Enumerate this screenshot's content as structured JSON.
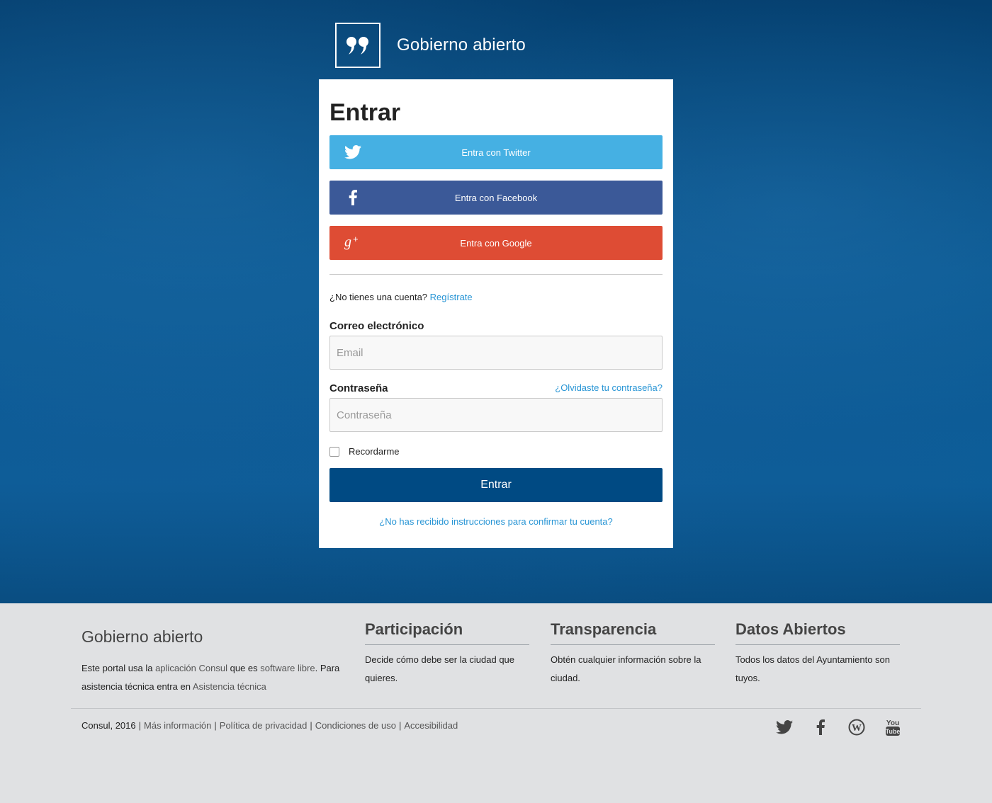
{
  "header": {
    "logo_text": "Gobierno abierto"
  },
  "login": {
    "title": "Entrar",
    "twitter_label": "Entra con Twitter",
    "facebook_label": "Entra con Facebook",
    "google_label": "Entra con Google",
    "no_account_text": "¿No tienes una cuenta?",
    "register_link": "Regístrate",
    "email_label": "Correo electrónico",
    "email_placeholder": "Email",
    "password_label": "Contraseña",
    "password_placeholder": "Contraseña",
    "forgot_link": "¿Olvidaste tu contraseña?",
    "remember_label": "Recordarme",
    "submit_label": "Entrar",
    "confirm_link": "¿No has recibido instrucciones para confirmar tu cuenta?"
  },
  "colors": {
    "twitter": "#45b0e3",
    "facebook": "#3b5998",
    "google": "#de4c34",
    "primary": "#004a83",
    "link": "#2895d5"
  },
  "footer": {
    "title": "Gobierno abierto",
    "desc_1": "Este portal usa la",
    "desc_link_1": "aplicación Consul",
    "desc_2": "que es",
    "desc_link_2": "software libre",
    "desc_3": ". Para asistencia técnica entra en",
    "desc_link_3": "Asistencia técnica",
    "columns": [
      {
        "title": "Participación",
        "text": "Decide cómo debe ser la ciudad que quieres."
      },
      {
        "title": "Transparencia",
        "text": "Obtén cualquier información sobre la ciudad."
      },
      {
        "title": "Datos Abiertos",
        "text": "Todos los datos del Ayuntamiento son tuyos."
      }
    ],
    "copyright": "Consul, 2016",
    "separator": "|",
    "links": [
      "Más información",
      "Política de privacidad",
      "Condiciones de uso",
      "Accesibilidad"
    ],
    "social_icons": [
      "twitter-icon",
      "facebook-icon",
      "wordpress-icon",
      "youtube-icon"
    ]
  }
}
